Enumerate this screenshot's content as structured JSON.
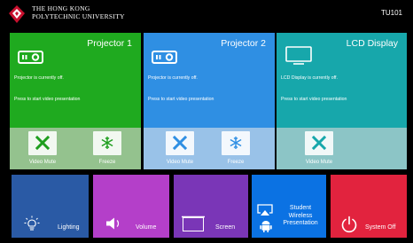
{
  "header": {
    "university_line1": "THE HONG KONG",
    "university_line2": "POLYTECHNIC UNIVERSITY",
    "room": "TU101"
  },
  "panels": [
    {
      "title": "Projector 1",
      "status": "Projector is currently off.",
      "prompt": "Press to start video presentation",
      "mute_label": "Video Mute",
      "freeze_label": "Freeze",
      "color_top": "#1faa1f",
      "color_bottom": "#94c28e",
      "accent": "#1e9e1e"
    },
    {
      "title": "Projector 2",
      "status": "Projector is currently off.",
      "prompt": "Press to start video presentation",
      "mute_label": "Video Mute",
      "freeze_label": "Freeze",
      "color_top": "#2f8fe3",
      "color_bottom": "#99c2e8",
      "accent": "#2f8fe3"
    },
    {
      "title": "LCD Display",
      "status": "LCD Display is currently off.",
      "prompt": "Press to start video presentation",
      "mute_label": "Video Mute",
      "color_top": "#17a7ab",
      "color_bottom": "#8cc5c6",
      "accent": "#17a7ab"
    }
  ],
  "buttons": {
    "lighting": {
      "label": "Lighting",
      "color": "#2a5aa5",
      "icon": "lightbulb-icon"
    },
    "volume": {
      "label": "Volume",
      "color": "#b43fc9",
      "icon": "speaker-icon"
    },
    "screen": {
      "label": "Screen",
      "color": "#7a36b7",
      "icon": "projection-screen-icon"
    },
    "student": {
      "label_line1": "Student",
      "label_line2": "Wireless",
      "label_line3": "Presentation",
      "color": "#0b72e3",
      "icon": "airplay-android-icon"
    },
    "system_off": {
      "label": "System Off",
      "color": "#e2233e",
      "icon": "power-icon"
    }
  }
}
